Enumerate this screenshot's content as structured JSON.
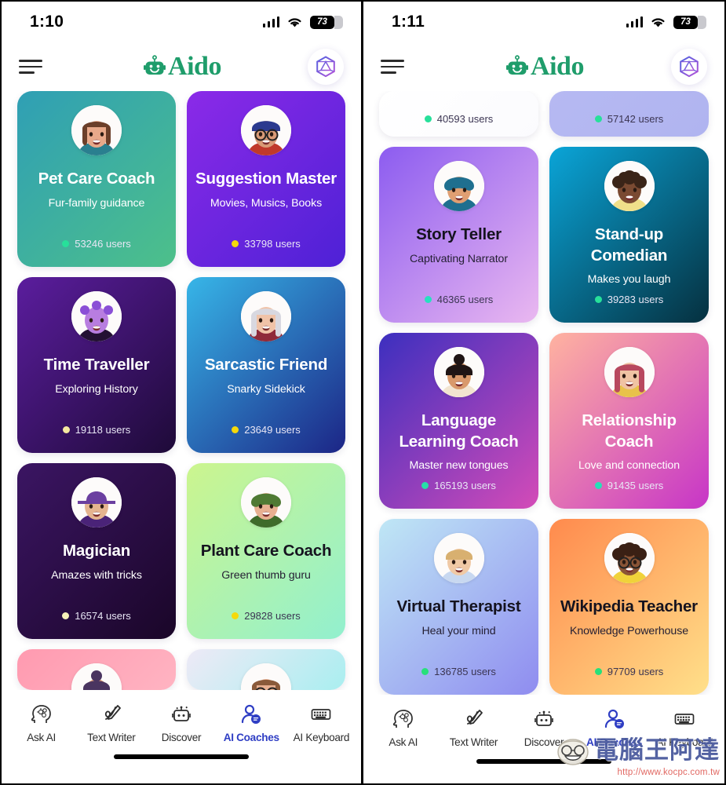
{
  "app": {
    "brand_name": "Aido",
    "brand_color": "#1f9d6b",
    "accent_color": "#2f3ec4"
  },
  "left_panel": {
    "status": {
      "time": "1:10",
      "battery": "73",
      "signal_icon": "signal-bars-icon",
      "wifi_icon": "wifi-icon",
      "battery_icon": "battery-icon"
    },
    "header": {
      "menu_icon": "hamburger-menu-icon",
      "logo_icon": "aido-robot-logo-icon",
      "title": "Aido",
      "gem_icon": "gem-diamond-icon"
    },
    "cards": [
      {
        "title": "Pet Care Coach",
        "subtitle": "Fur-family guidance",
        "users": "53246 users",
        "dot": "#27e09a",
        "text": "light",
        "g1": "#2f9fb5",
        "g2": "#4dc08a",
        "avatar": "pet-care-coach-avatar"
      },
      {
        "title": "Suggestion Master",
        "subtitle": "Movies, Musics, Books",
        "users": "33798 users",
        "dot": "#f5d90a",
        "text": "light",
        "g1": "#8b2ae8",
        "g2": "#4e21d6",
        "avatar": "suggestion-master-avatar"
      },
      {
        "title": "Time Traveller",
        "subtitle": "Exploring History",
        "users": "19118 users",
        "dot": "#f5e9a0",
        "text": "light",
        "g1": "#5b1d9e",
        "g2": "#1e0a38",
        "avatar": "time-traveller-avatar"
      },
      {
        "title": "Sarcastic Friend",
        "subtitle": "Snarky Sidekick",
        "users": "23649 users",
        "dot": "#f5d90a",
        "text": "light",
        "g1": "#37b6e8",
        "g2": "#1c2586",
        "avatar": "sarcastic-friend-avatar"
      },
      {
        "title": "Magician",
        "subtitle": "Amazes with tricks",
        "users": "16574 users",
        "dot": "#f7f0b8",
        "text": "light",
        "g1": "#3b1563",
        "g2": "#1a0628",
        "avatar": "magician-avatar"
      },
      {
        "title": "Plant Care Coach",
        "subtitle": "Green thumb guru",
        "users": "29828 users",
        "dot": "#f5d90a",
        "text": "dark",
        "g1": "#ccf58e",
        "g2": "#92f0cf",
        "avatar": "plant-care-coach-avatar"
      }
    ],
    "partial_bottom_cards": [
      {
        "g1": "#ff9ab0",
        "g2": "#ffb4c2",
        "avatar": "pink-card-avatar"
      },
      {
        "g1": "#eeeaf6",
        "g2": "#a9eef0",
        "avatar": "mint-card-avatar"
      }
    ],
    "nav": {
      "items": [
        {
          "label": "Ask AI",
          "icon": "brain-head-icon",
          "active": false
        },
        {
          "label": "Text Writer",
          "icon": "pen-scribble-icon",
          "active": false
        },
        {
          "label": "Discover",
          "icon": "robot-face-sparkle-icon",
          "active": false
        },
        {
          "label": "AI Coaches",
          "icon": "person-chat-icon",
          "active": true
        },
        {
          "label": "AI Keyboard",
          "icon": "keyboard-icon",
          "active": false
        }
      ]
    }
  },
  "right_panel": {
    "status": {
      "time": "1:11",
      "battery": "73",
      "signal_icon": "signal-bars-icon",
      "wifi_icon": "wifi-icon",
      "battery_icon": "battery-icon"
    },
    "header": {
      "menu_icon": "hamburger-menu-icon",
      "logo_icon": "aido-robot-logo-icon",
      "title": "Aido",
      "gem_icon": "gem-diamond-icon"
    },
    "partial_top_cards": [
      {
        "users": "40593 users",
        "dot": "#27e09a",
        "text": "dark",
        "g1": "#ffffff",
        "g2": "#fbfbfe"
      },
      {
        "users": "57142 users",
        "dot": "#27e09a",
        "text": "dark",
        "g1": "#b6b9f2",
        "g2": "#b0b4f0"
      }
    ],
    "cards": [
      {
        "title": "Story Teller",
        "subtitle": "Captivating Narrator",
        "users": "46365 users",
        "dot": "#27e0c0",
        "text": "dark",
        "g1": "#8c5cf0",
        "g2": "#eab8f0",
        "avatar": "story-teller-avatar"
      },
      {
        "title": "Stand-up Comedian",
        "subtitle": "Makes you laugh",
        "users": "39283 users",
        "dot": "#27e09a",
        "text": "light",
        "g1": "#0aa5d8",
        "g2": "#05303f",
        "avatar": "standup-comedian-avatar"
      },
      {
        "title": "Language Learning Coach",
        "subtitle": "Master new tongues",
        "users": "165193 users",
        "dot": "#27e0a8",
        "text": "light",
        "g1": "#3c2fbf",
        "g2": "#d44bb8",
        "avatar": "language-learning-coach-avatar"
      },
      {
        "title": "Relationship Coach",
        "subtitle": "Love and connection",
        "users": "91435 users",
        "dot": "#27e0b8",
        "text": "light",
        "g1": "#ffb3a0",
        "g2": "#c735c7",
        "avatar": "relationship-coach-avatar"
      },
      {
        "title": "Virtual Therapist",
        "subtitle": "Heal your mind",
        "users": "136785 users",
        "dot": "#27e07a",
        "text": "dark",
        "g1": "#bfe7f5",
        "g2": "#8f8cf0",
        "avatar": "virtual-therapist-avatar"
      },
      {
        "title": "Wikipedia Teacher",
        "subtitle": "Knowledge Powerhouse",
        "users": "97709 users",
        "dot": "#27e07a",
        "text": "dark",
        "g1": "#ff8a4d",
        "g2": "#ffe08a",
        "avatar": "wikipedia-teacher-avatar"
      }
    ],
    "nav": {
      "items": [
        {
          "label": "Ask AI",
          "icon": "brain-head-icon",
          "active": false
        },
        {
          "label": "Text Writer",
          "icon": "pen-scribble-icon",
          "active": false
        },
        {
          "label": "Discover",
          "icon": "robot-face-sparkle-icon",
          "active": false
        },
        {
          "label": "AI Coaches",
          "icon": "person-chat-icon",
          "active": true
        },
        {
          "label": "AI Keyboard",
          "icon": "keyboard-icon",
          "active": false
        }
      ]
    }
  },
  "watermark": {
    "text": "電腦王阿達",
    "url": "http://www.kocpc.com.tw",
    "face_icon": "mascot-face-icon"
  }
}
